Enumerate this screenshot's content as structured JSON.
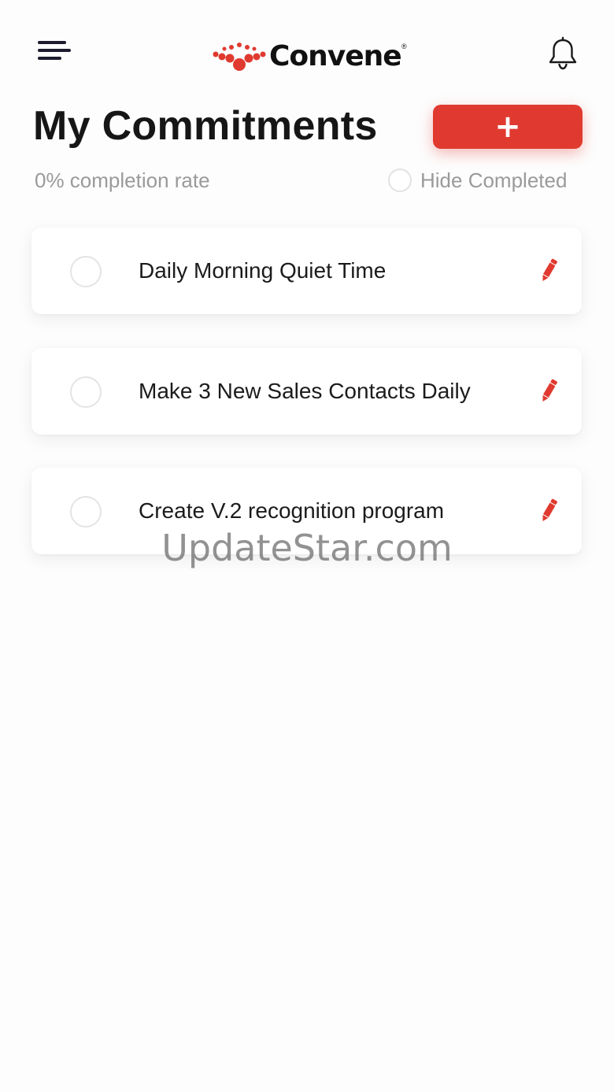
{
  "header": {
    "logo_text": "Convene",
    "logo_reg": "®",
    "menu_icon": "hamburger-menu-icon",
    "notification_icon": "bell-icon"
  },
  "page": {
    "title": "My Commitments",
    "add_button_label": "+",
    "completion_rate": "0% completion rate",
    "hide_completed_label": "Hide Completed"
  },
  "commitments": [
    {
      "label": "Daily Morning Quiet Time",
      "completed": false
    },
    {
      "label": "Make 3 New Sales Contacts Daily",
      "completed": false
    },
    {
      "label": "Create V.2 recognition program",
      "completed": false
    }
  ],
  "watermark": "UpdateStar.com",
  "colors": {
    "accent": "#e03a30",
    "text_primary": "#161616",
    "text_muted": "#9a9a9a",
    "background": "#fdfdfd"
  }
}
